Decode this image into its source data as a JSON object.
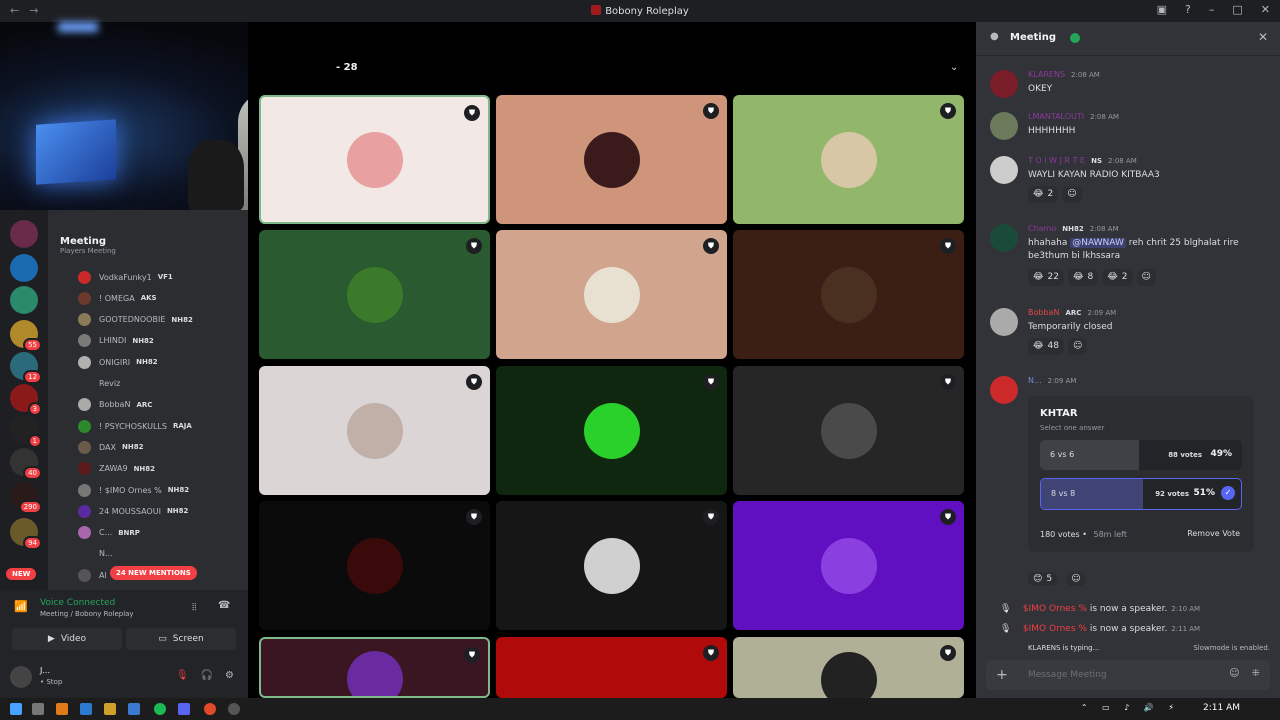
{
  "window": {
    "title": "Bobony Roleplay",
    "back": "←",
    "forward": "→"
  },
  "channel_panel": {
    "server_channel": "Meeting",
    "server_sub": "Players Meeting",
    "members": [
      {
        "name": "VodkaFunky1",
        "tag": "VF1",
        "color": "#cc2a2a"
      },
      {
        "name": "! OMEGA",
        "tag": "AKS",
        "color": "#6b3a2a"
      },
      {
        "name": "GOOTEDNOOBIE",
        "tag": "NH82",
        "color": "#8a7a5a"
      },
      {
        "name": "LHINDI",
        "tag": "NH82",
        "color": "#7a7a7a"
      },
      {
        "name": "ONIGIRI",
        "tag": "NH82",
        "color": "#b0b0b0"
      },
      {
        "name": "Reviz",
        "tag": "",
        "color": "#2b2d31"
      },
      {
        "name": "BobbaN",
        "tag": "ARC",
        "color": "#aaaaaa"
      },
      {
        "name": "! PSYCHOSKULLS",
        "tag": "RAJA",
        "color": "#2b8a2b"
      },
      {
        "name": "DAX",
        "tag": "NH82",
        "color": "#6a5a4a"
      },
      {
        "name": "ZAWA9",
        "tag": "NH82",
        "color": "#5a1a1a"
      },
      {
        "name": "! $IMO Ornes %",
        "tag": "NH82",
        "color": "#777777"
      },
      {
        "name": "24 MOUSSAOUI",
        "tag": "NH82",
        "color": "#5a2aa0"
      },
      {
        "name": "C...",
        "tag": "BNRP",
        "color": "#aa66aa"
      },
      {
        "name": "N...",
        "tag": "",
        "color": "#2b2d31"
      },
      {
        "name": "Al",
        "tag": "",
        "color": "#555555"
      }
    ],
    "mentions_pill": "24 NEW MENTIONS",
    "new_pill": "NEW"
  },
  "guild_badges": [
    "55",
    "12",
    "3",
    "1",
    "40",
    "290",
    "94"
  ],
  "voice": {
    "status": "Voice Connected",
    "channel": "Meeting",
    "server": "/ Bobony Roleplay",
    "video_label": "Video",
    "screen_label": "Screen",
    "user_name": "J...",
    "user_status": "• Stop"
  },
  "stage": {
    "participant_count": "- 28"
  },
  "chat": {
    "title": "Meeting",
    "messages": [
      {
        "author": "KLARENS",
        "time": "2:08 AM",
        "text": "OKEY",
        "color": "#8b3a9a",
        "avatar": "#7a1f2a"
      },
      {
        "author": "LMANTALOUTI",
        "time": "2:08 AM",
        "text": "HHHHHHH",
        "color": "#8b3a9a",
        "avatar": "#6a7a5a"
      },
      {
        "author": "T O I W J R T E",
        "tags": "NS",
        "time": "2:08 AM",
        "text": "WAYLI KAYAN RADIO KITBAA3",
        "color": "#8b3a9a",
        "avatar": "#cccccc",
        "reactions": [
          "2"
        ]
      },
      {
        "author": "Chamo",
        "tags": "NH82",
        "time": "2:08 AM",
        "text_pre": "hhahaha",
        "mention": "@NAWNAW",
        "text_post": "reh chrit 25 blghalat rire be3thum bi lkhssara",
        "color": "#8b3a9a",
        "avatar": "#1a4a3a",
        "reactions": [
          "22",
          "8",
          "2"
        ]
      },
      {
        "author": "BobbaN",
        "tags": "ARC",
        "time": "2:09 AM",
        "text": "Temporarily closed",
        "color": "#e04848",
        "avatar": "#aaaaaa",
        "reactions": [
          "48"
        ]
      },
      {
        "author": "N...",
        "time": "2:09 AM",
        "color": "#7289da",
        "avatar": "#cc2a2a"
      }
    ],
    "poll": {
      "question": "KHTAR",
      "hint": "Select one answer",
      "options": [
        {
          "label": "6 vs 6",
          "votes": "88 votes",
          "pct": "49%"
        },
        {
          "label": "8 vs 8",
          "votes": "92 votes",
          "pct": "51%"
        }
      ],
      "total": "180 votes",
      "time_left": "58m left",
      "remove": "Remove Vote",
      "reaction": "5"
    },
    "system": [
      {
        "name": "$IMO Ornes %",
        "text": "is now a speaker.",
        "time": "2:10 AM"
      },
      {
        "name": "$IMO Ornes %",
        "text": "is now a speaker.",
        "time": "2:11 AM"
      }
    ],
    "typing": "KLARENS is typing...",
    "slowmode": "Slowmode is enabled.",
    "placeholder": "Message Meeting"
  },
  "taskbar": {
    "clock": "2:11 AM"
  }
}
